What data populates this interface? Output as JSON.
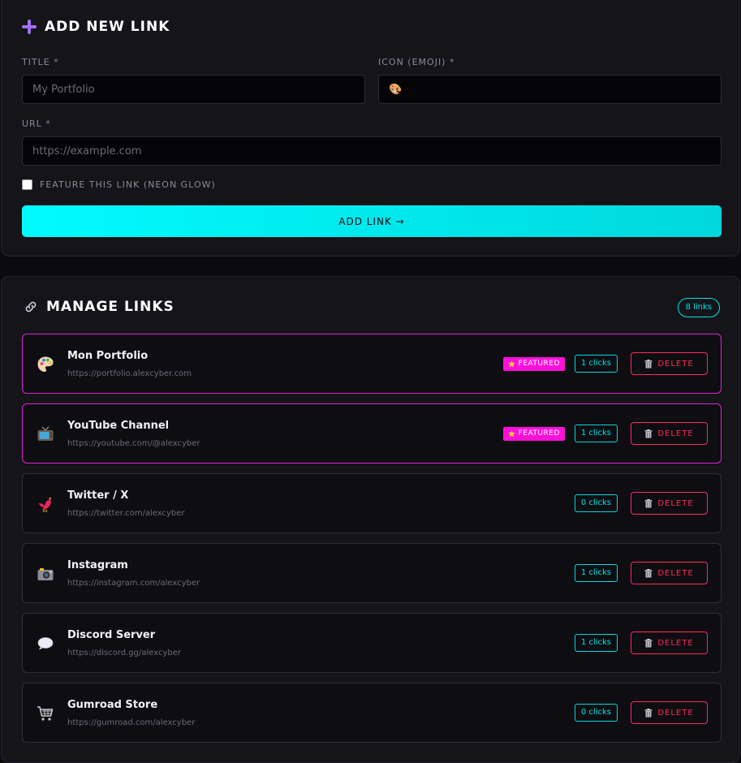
{
  "add_form": {
    "title": "ADD NEW LINK",
    "title_label": "TITLE *",
    "title_placeholder": "My Portfolio",
    "icon_label": "ICON (EMOJI) *",
    "icon_value": "🎨",
    "url_label": "URL *",
    "url_placeholder": "https://example.com",
    "feature_label": "FEATURE THIS LINK (NEON GLOW)",
    "submit_label": "ADD LINK →"
  },
  "manage": {
    "title": "MANAGE LINKS",
    "count_label": "8 links",
    "featured_label": "FEATURED",
    "delete_label": "DELETE",
    "links": [
      {
        "title": "Mon Portfolio",
        "url": "https://portfolio.alexcyber.com",
        "clicks": "1 clicks",
        "icon": "palette-icon",
        "featured": true
      },
      {
        "title": "YouTube Channel",
        "url": "https://youtube.com/@alexcyber",
        "clicks": "1 clicks",
        "icon": "tv-icon",
        "featured": true
      },
      {
        "title": "Twitter / X",
        "url": "https://twitter.com/alexcyber",
        "clicks": "0 clicks",
        "icon": "bird-icon",
        "featured": false
      },
      {
        "title": "Instagram",
        "url": "https://instagram.com/alexcyber",
        "clicks": "1 clicks",
        "icon": "camera-icon",
        "featured": false
      },
      {
        "title": "Discord Server",
        "url": "https://discord.gg/alexcyber",
        "clicks": "1 clicks",
        "icon": "speech-bubble-icon",
        "featured": false
      },
      {
        "title": "Gumroad Store",
        "url": "https://gumroad.com/alexcyber",
        "clicks": "0 clicks",
        "icon": "shopping-cart-icon",
        "featured": false
      }
    ]
  },
  "colors": {
    "accent_cyan": "#00fbff",
    "accent_magenta": "#ff10d8",
    "danger": "#ff2a55",
    "background": "#0b0b0e",
    "panel": "#141419"
  }
}
